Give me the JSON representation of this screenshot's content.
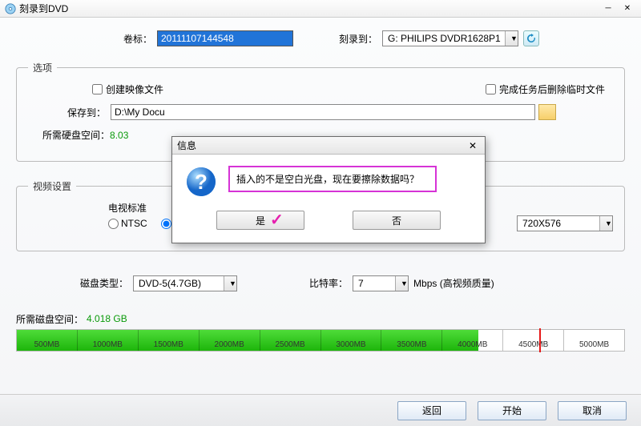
{
  "window": {
    "title": "刻录到DVD"
  },
  "top": {
    "volume_label_label": "卷标：",
    "volume_label_value": "20111107144548",
    "burn_to_label": "刻录到：",
    "burn_to_value": "G: PHILIPS  DVDR1628P1"
  },
  "options": {
    "legend": "选项",
    "create_image_label": "创建映像文件",
    "delete_temp_label": "完成任务后删除临时文件",
    "save_to_label": "保存到：",
    "save_to_value": "D:\\My Docu",
    "disk_space_label": "所需硬盘空间：",
    "disk_space_value": "8.03"
  },
  "video": {
    "legend": "视频设置",
    "tv_standard_label": "电视标准",
    "ntsc": "NTSC",
    "resolution": "720X576"
  },
  "disc": {
    "type_label": "磁盘类型：",
    "type_value": "DVD-5(4.7GB)",
    "bitrate_label": "比特率：",
    "bitrate_value": "7",
    "bitrate_unit": "Mbps  (高视频质量)"
  },
  "bar": {
    "label": "所需磁盘空间：",
    "value": "4.018 GB",
    "ticks": [
      "500MB",
      "1000MB",
      "1500MB",
      "2000MB",
      "2500MB",
      "3000MB",
      "3500MB",
      "4000MB",
      "4500MB",
      "5000MB"
    ],
    "fill_percent": 76,
    "red_marker_percent": 86
  },
  "footer": {
    "back": "返回",
    "start": "开始",
    "cancel": "取消"
  },
  "modal": {
    "title": "信息",
    "message": "插入的不是空白光盘，现在要擦除数据吗？",
    "yes": "是",
    "no": "否"
  }
}
